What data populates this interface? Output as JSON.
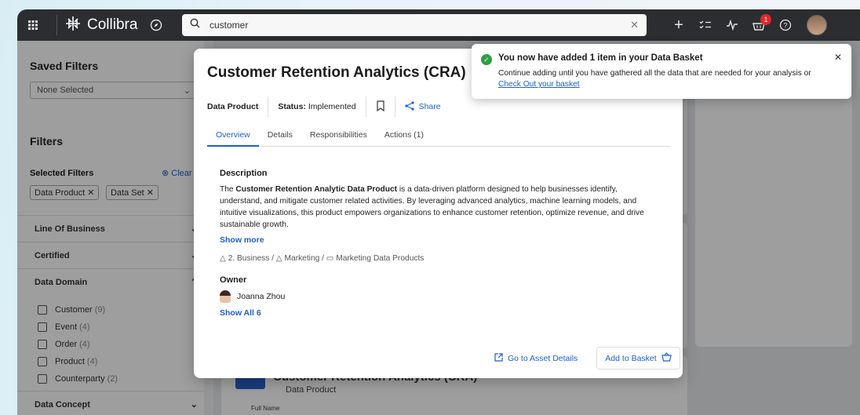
{
  "topbar": {
    "brand": "Collibra",
    "search_value": "customer",
    "basket_count": "1"
  },
  "filters": {
    "saved_title": "Saved Filters",
    "saved_select": "None Selected",
    "filters_title": "Filters",
    "selected_title": "Selected Filters",
    "clear_label": "Clear",
    "chips": [
      "Data Product",
      "Data Set"
    ],
    "sections": {
      "line_of_business": "Line Of Business",
      "certified": "Certified",
      "data_domain": "Data Domain",
      "data_concept": "Data Concept"
    },
    "domain_items": [
      {
        "label": "Customer",
        "count": "(9)"
      },
      {
        "label": "Event",
        "count": "(4)"
      },
      {
        "label": "Order",
        "count": "(4)"
      },
      {
        "label": "Product",
        "count": "(4)"
      },
      {
        "label": "Counterparty",
        "count": "(2)"
      }
    ]
  },
  "background": {
    "card_title": "Customer Retention Analytics (CRA)",
    "card_type": "Data Product",
    "card_field": "Full Name"
  },
  "modal": {
    "title": "Customer Retention Analytics (CRA)",
    "type": "Data Product",
    "status_label": "Status:",
    "status_value": "Implemented",
    "share_label": "Share",
    "tabs": [
      "Overview",
      "Details",
      "Responsibilities",
      "Actions (1)"
    ],
    "description_heading": "Description",
    "description_prefix": "The ",
    "description_bold": "Customer Retention Analytic Data Product",
    "description_rest": " is a data-driven platform designed to help businesses identify, understand, and mitigate customer related activities. By leveraging advanced analytics, machine learning models, and intuitive visualizations, this product empowers organizations to enhance customer retention, optimize revenue, and drive sustainable growth.",
    "show_more": "Show more",
    "breadcrumb_1": "2. Business",
    "breadcrumb_2": "Marketing",
    "breadcrumb_3": "Marketing Data Products",
    "owner_heading": "Owner",
    "owner_name": "Joanna Zhou",
    "show_all": "Show All 6",
    "go_to_details": "Go to Asset Details",
    "add_to_basket": "Add to Basket"
  },
  "toast": {
    "title": "You now have added 1 item in your Data Basket",
    "body": "Continue adding until you have gathered all the data that are needed for your analysis or",
    "link": "Check Out your basket"
  },
  "colors": {
    "accent": "#1f5fcf",
    "topbar": "#2b2d31",
    "success": "#2f9e44",
    "badge": "#e5252a"
  }
}
